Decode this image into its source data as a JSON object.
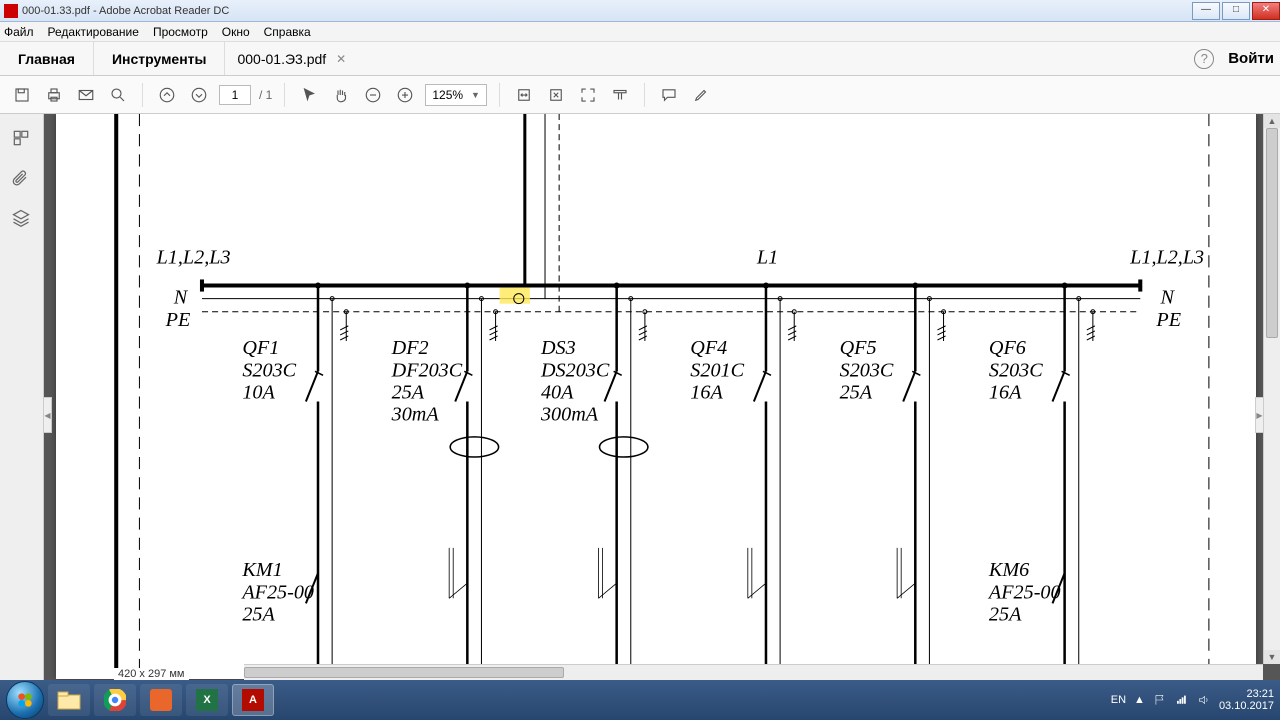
{
  "window": {
    "title": "000-01.33.pdf - Adobe Acrobat Reader DC"
  },
  "menu": {
    "file": "Файл",
    "edit": "Редактирование",
    "view": "Просмотр",
    "window": "Окно",
    "help": "Справка"
  },
  "tabs": {
    "home": "Главная",
    "tools": "Инструменты",
    "doc": "000-01.Э3.pdf",
    "signin": "Войти"
  },
  "toolbar": {
    "page_current": "1",
    "page_total": "/ 1",
    "zoom": "125%"
  },
  "status": {
    "dims": "420 x 297 мм"
  },
  "diagram": {
    "top_left": "L1,L2,L3",
    "top_mid": "L1",
    "top_right": "L1,L2,L3",
    "n_left": "N",
    "pe_left": "PE",
    "n_right": "N",
    "pe_right": "PE",
    "branches": [
      {
        "l1": "QF1",
        "l2": "S203C",
        "l3": "10A",
        "l4": ""
      },
      {
        "l1": "DF2",
        "l2": "DF203C",
        "l3": "25A",
        "l4": "30mA"
      },
      {
        "l1": "DS3",
        "l2": "DS203C",
        "l3": "40A",
        "l4": "300mA"
      },
      {
        "l1": "QF4",
        "l2": "S201C",
        "l3": "16A",
        "l4": ""
      },
      {
        "l1": "QF5",
        "l2": "S203C",
        "l3": "25A",
        "l4": ""
      },
      {
        "l1": "QF6",
        "l2": "S203C",
        "l3": "16A",
        "l4": ""
      }
    ],
    "contactors": [
      {
        "x": 0,
        "l1": "KM1",
        "l2": "AF25-00",
        "l3": "25A"
      },
      {
        "x": 5,
        "l1": "KM6",
        "l2": "AF25-00",
        "l3": "25A"
      }
    ]
  },
  "tray": {
    "lang": "EN",
    "time": "23:21",
    "date": "03.10.2017"
  }
}
